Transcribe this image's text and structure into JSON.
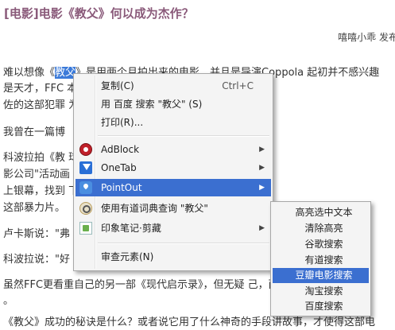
{
  "article": {
    "title": "[电影]电影《教父》何以成为杰作？",
    "byline": "嘻嘻小乖 发布",
    "lines": [
      {
        "pre": "难以想像《",
        "hl": "教父",
        "post": "》是用两个月拍出来的电影，并且是导演Coppola 起初并不感兴趣"
      },
      {
        "text": "是天才，FFC                                                                              本，并且获得了奥斯卡原创"
      },
      {
        "text": "佐的这部犯罪                                                                      为电影史上的经典。"
      },
      {
        "text": "我曾在一篇博"
      },
      {
        "text": "科波拉拍《教                                                                          球大战》的乔治·卢卡斯共同"
      },
      {
        "text": "影公司\"活动画                                                                        元。当时，派拉蒙公司准备"
      },
      {
        "text": "上银幕，找到                                                                                                        下去，"
      },
      {
        "text": "这部暴力片。"
      },
      {
        "text": "卢卡斯说：\"弗"
      },
      {
        "text": "科波拉说：\"好"
      },
      {
        "text": "虽然FFC更看重自己的另一部《现代启示录》，但无疑                                        己，而"
      },
      {
        "text": "。"
      },
      {
        "text": "《教父》成功的秘诀是什么？或者说它用了什么神奇的手段讲故事，才使得这部电"
      }
    ]
  },
  "context_menu": {
    "items": [
      {
        "label": "复制(C)",
        "shortcut": "Ctrl+C"
      },
      {
        "label": "用 百度 搜索 \"教父\" (S)"
      },
      {
        "label": "打印(R)..."
      },
      {
        "label": "AdBlock",
        "icon": "adblock-icon",
        "has_submenu": true
      },
      {
        "label": "OneTab",
        "icon": "onetab-icon",
        "has_submenu": true
      },
      {
        "label": "PointOut",
        "icon": "pointout-icon",
        "has_submenu": true,
        "active": true
      },
      {
        "label": "使用有道词典查询 \"教父\"",
        "icon": "youdao-dictionary-icon"
      },
      {
        "label": "印象笔记·剪藏",
        "icon": "evernote-icon",
        "has_submenu": true
      },
      {
        "label": "审查元素(N)"
      }
    ],
    "arrow_glyph": "▶"
  },
  "submenu": {
    "items": [
      {
        "label": "高亮选中文本"
      },
      {
        "label": "清除高亮"
      },
      {
        "label": "谷歌搜索"
      },
      {
        "label": "有道搜索"
      },
      {
        "label": "豆瓣电影搜索",
        "active": true
      },
      {
        "label": "淘宝搜索"
      },
      {
        "label": "百度搜索"
      }
    ]
  },
  "colors": {
    "accent": "#3b6fd0",
    "title": "#8a5a7a",
    "menu_bg": "#f4f4f4"
  }
}
